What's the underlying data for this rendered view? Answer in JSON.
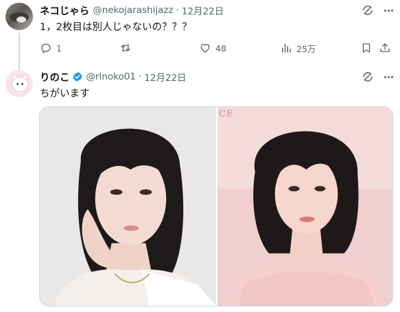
{
  "tweets": [
    {
      "display_name": "ネコじゃら",
      "handle": "@nekojarashijazz",
      "separator": "·",
      "date": "12月22日",
      "text": "1，2枚目は別人じゃないの？？？",
      "actions": {
        "reply_count": "1",
        "retweet_count": "",
        "like_count": "48",
        "view_count": "25万"
      }
    },
    {
      "display_name": "りのこ",
      "handle": "@rinoko01",
      "separator": "·",
      "date": "12月22日",
      "text": "ちがいます",
      "verified": true,
      "media": {
        "magazine_text": "CE"
      }
    }
  ],
  "colors": {
    "text_primary": "#0f1419",
    "text_secondary": "#536471",
    "verified_blue": "#1d9bf0",
    "border": "#cfd9de"
  },
  "icons": [
    "grok-icon",
    "more-icon",
    "reply-icon",
    "retweet-icon",
    "like-icon",
    "views-icon",
    "bookmark-icon",
    "share-icon",
    "verified-badge-icon"
  ]
}
